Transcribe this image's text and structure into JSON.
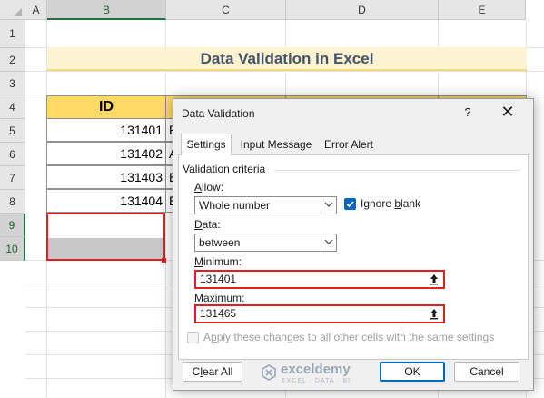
{
  "sheet": {
    "columns": [
      "A",
      "B",
      "C",
      "D",
      "E"
    ],
    "rows": [
      "1",
      "2",
      "3",
      "4",
      "5",
      "6",
      "7",
      "8",
      "9",
      "10"
    ],
    "title": "Data Validation in Excel",
    "table_header": "ID",
    "ids": [
      "131401",
      "131402",
      "131403",
      "131404"
    ],
    "col_c_partial": [
      "R",
      "A",
      "E",
      "E"
    ],
    "colors": {
      "title_bg": "#fdf3d0",
      "header_bg": "#ffd966",
      "selection": "#e02020",
      "selected_header": "#d2d2d2"
    }
  },
  "dialog": {
    "title": "Data Validation",
    "help_glyph": "?",
    "close_glyph": "✕",
    "tabs": [
      "Settings",
      "Input Message",
      "Error Alert"
    ],
    "active_tab": "Settings",
    "group_label": "Validation criteria",
    "allow": {
      "mn": "A",
      "rest": "llow:"
    },
    "allow_value": "Whole number",
    "ignore_blank": {
      "pre": "Ignore ",
      "mn": "b",
      "post": "lank",
      "checked": true
    },
    "data": {
      "mn": "D",
      "rest": "ata:"
    },
    "data_value": "between",
    "minimum": {
      "mn": "M",
      "rest": "inimum:"
    },
    "minimum_value": "131401",
    "maximum": {
      "mn": "M",
      "rest": "a",
      "mn2": "x",
      "rest2": "imum:"
    },
    "maximum_value": "131465",
    "apply_all": {
      "pre": "A",
      "mn": "p",
      "post": "ply these changes to all other cells with the same settings",
      "checked": false
    },
    "clear_all": {
      "pre": "C",
      "mn": "l",
      "post": "ear All"
    },
    "ok": "OK",
    "cancel": "Cancel"
  },
  "watermark": {
    "name": "exceldemy",
    "sub": "EXCEL · DATA · BI"
  }
}
